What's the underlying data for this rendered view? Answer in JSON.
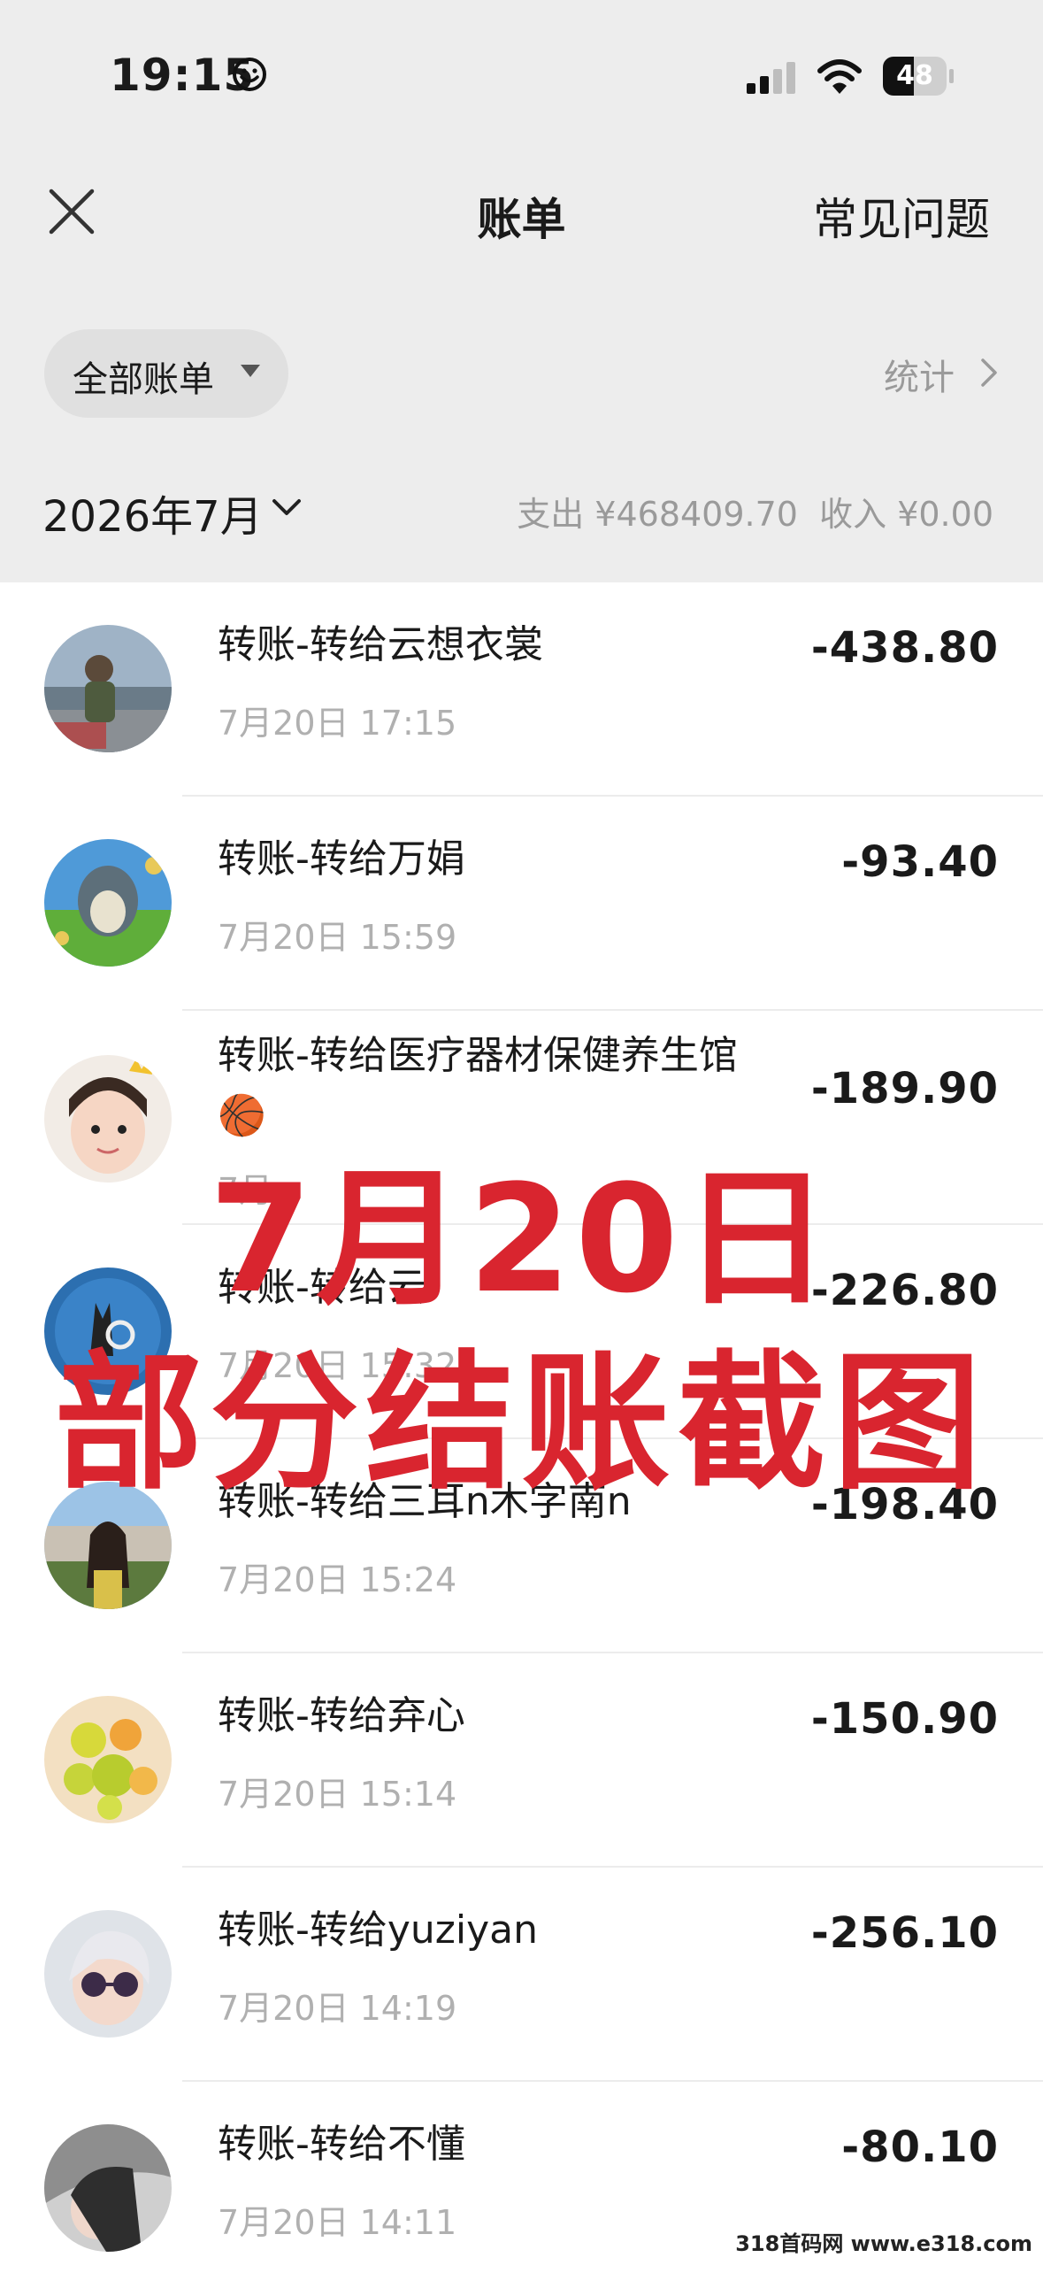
{
  "status": {
    "time": "19:15",
    "battery": "48",
    "battery_level": 0.48
  },
  "nav": {
    "title": "账单",
    "faq": "常见问题"
  },
  "filter": {
    "label": "全部账单",
    "stats": "统计"
  },
  "period": {
    "month": "2026年7月",
    "expense": "支出 ¥468409.70",
    "income": "收入 ¥0.00"
  },
  "transactions": [
    {
      "name": "转账-转给云想衣裳",
      "date": "7月20日 17:15",
      "amount": "-438.80"
    },
    {
      "name": "转账-转给万娟",
      "date": "7月20日 15:59",
      "amount": "-93.40"
    },
    {
      "name": "转账-转给医疗器材保健养生馆",
      "emoji": "🏀",
      "date": "7月",
      "amount": "-189.90"
    },
    {
      "name": "转账-转给云",
      "date": "7月20日 15:32",
      "amount": "-226.80"
    },
    {
      "name": "转账-转给三耳n木字南n",
      "date": "7月20日 15:24",
      "amount": "-198.40"
    },
    {
      "name": "转账-转给弃心",
      "date": "7月20日 15:14",
      "amount": "-150.90"
    },
    {
      "name": "转账-转给yuziyan",
      "date": "7月20日 14:19",
      "amount": "-256.10"
    },
    {
      "name": "转账-转给不懂",
      "date": "7月20日 14:11",
      "amount": "-80.10"
    }
  ],
  "overlay": {
    "line1": "7月20日",
    "line2": "部分结账截图"
  },
  "watermark": "318首码网 www.e318.com",
  "colors": {
    "header_bg": "#ededed",
    "overlay_red": "#d9252f",
    "muted": "#9a9a9a"
  }
}
